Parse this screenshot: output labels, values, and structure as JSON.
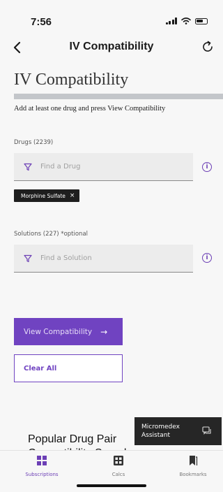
{
  "status_bar": {
    "time": "7:56"
  },
  "nav": {
    "title": "IV Compatibility",
    "back_icon": "chevron-left-icon",
    "refresh_icon": "refresh-icon"
  },
  "page": {
    "heading": "IV Compatibility",
    "instruction": "Add at least one drug and press View Compatibility"
  },
  "drugs": {
    "label": "Drugs (2239)",
    "placeholder": "Find a Drug",
    "selected": [
      {
        "label": "Morphine Sulfate",
        "remove": "×"
      }
    ]
  },
  "solutions": {
    "label": "Solutions (227) *optional",
    "placeholder": "Find a Solution"
  },
  "actions": {
    "view_label": "View Compatibility",
    "view_arrow": "→",
    "clear_label": "Clear All"
  },
  "popular": {
    "heading": "Popular Drug Pair",
    "heading_cont": "Compatibility Search"
  },
  "assistant": {
    "label": "Micromedex Assistant"
  },
  "tabs": [
    {
      "label": "Subscriptions",
      "icon": "grid-icon",
      "active": true
    },
    {
      "label": "Calcs",
      "icon": "calculator-icon",
      "active": false
    },
    {
      "label": "Bookmarks",
      "icon": "bookmark-icon",
      "active": false
    }
  ],
  "colors": {
    "accent": "#7043c1",
    "chip_bg": "#1e1e1e",
    "rule": "#c3c6ca"
  }
}
